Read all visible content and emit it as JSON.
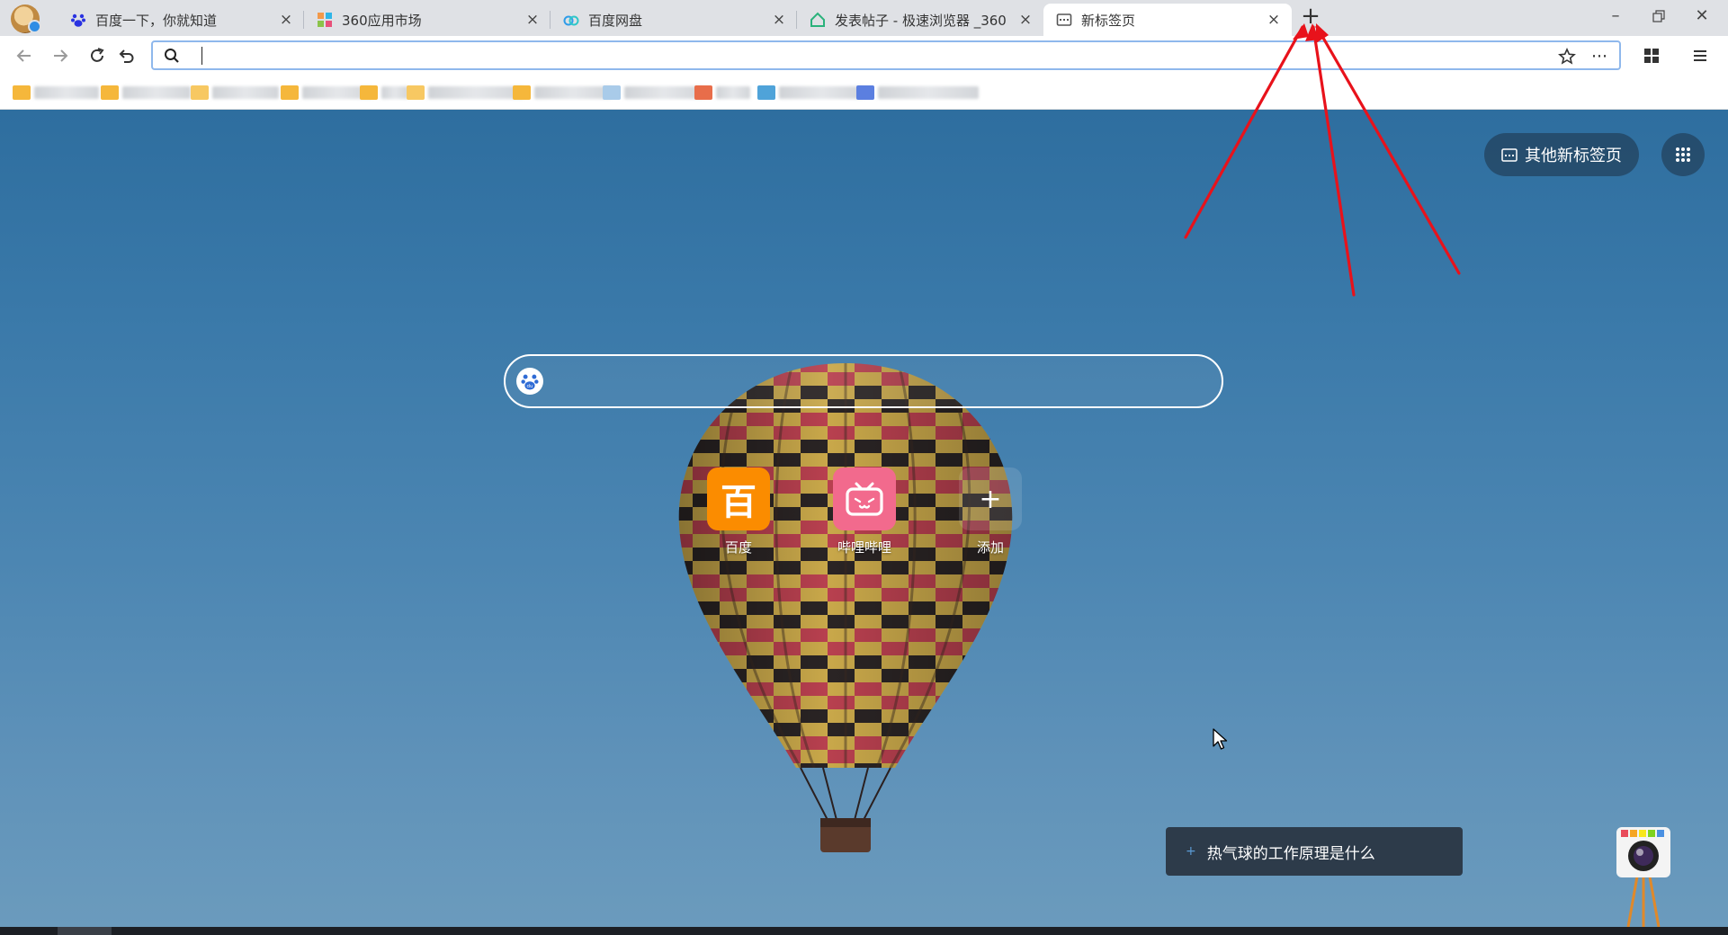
{
  "tabs": [
    {
      "label": "百度一下，你就知道",
      "favicon": "baidu-paw-icon",
      "active": false
    },
    {
      "label": "360应用市场",
      "favicon": "app-market-icon",
      "active": false
    },
    {
      "label": "百度网盘",
      "favicon": "cloud-drive-icon",
      "active": false
    },
    {
      "label": "发表帖子 - 极速浏览器 _360",
      "favicon": "360-house-icon",
      "active": false
    },
    {
      "label": "新标签页",
      "favicon": "newtab-page-icon",
      "active": true
    }
  ],
  "new_tab_button_icon": "plus-icon",
  "window_controls": [
    "minimize-icon",
    "restore-icon",
    "close-icon"
  ],
  "toolbar": {
    "nav_icons": [
      "back-arrow-icon",
      "forward-arrow-icon",
      "reload-icon",
      "undo-icon"
    ],
    "address_value": "",
    "address_icons": [
      "search-icon",
      "star-icon",
      "more-icon"
    ],
    "right_icons": [
      "grid-icon",
      "menu-icon"
    ]
  },
  "bookmarks_blurred": true,
  "newtab": {
    "other_newtab_label": "其他新标签页",
    "search_engine_icon": "baidu-icon",
    "search_value": "",
    "shortcuts": [
      {
        "label": "百度",
        "glyph": "百",
        "color": "#fb8c00"
      },
      {
        "label": "哔哩哔哩",
        "glyph": "bilibili-tv-icon",
        "color": "#f26a8d"
      },
      {
        "label": "添加",
        "glyph": "+",
        "color": "rgba(255,255,255,0.12)"
      }
    ],
    "tip_text": "热气球的工作原理是什么",
    "tip_icon": "plus-icon"
  },
  "colors": {
    "annotation_arrow": "#e8121b",
    "tab_strip": "#dfe1e5",
    "address_border": "#8fb8ec"
  }
}
